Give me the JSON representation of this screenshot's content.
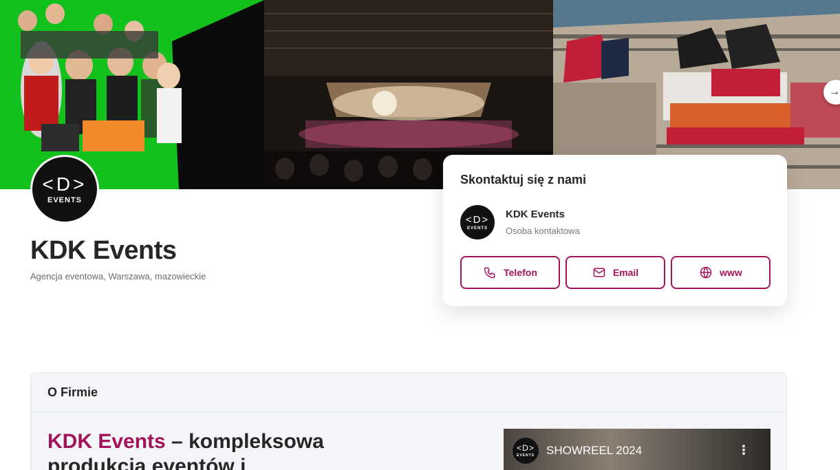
{
  "gallery": {
    "next_icon": "arrow-right-icon",
    "next_glyph": "→"
  },
  "profile": {
    "logo_mark": "‹D‹",
    "logo_sub": "EVENTS",
    "name": "KDK Events",
    "meta": "Agencja eventowa, Warszawa, mazowieckie"
  },
  "contact": {
    "title": "Skontaktuj się z nami",
    "person_name": "KDK Events",
    "person_role": "Osoba kontaktowa",
    "buttons": [
      {
        "label": "Telefon",
        "icon": "phone-icon"
      },
      {
        "label": "Email",
        "icon": "mail-icon"
      },
      {
        "label": "www",
        "icon": "globe-icon"
      }
    ]
  },
  "about": {
    "header": "O Firmie",
    "heading_brand": "KDK Events",
    "heading_rest": " – kompleksowa produkcja eventów i",
    "video_title": "SHOWREEL 2024",
    "video_menu": "⋮"
  },
  "colors": {
    "accent": "#a3135c",
    "text": "#262626",
    "muted": "#6b6b6b",
    "section_bg": "#f3f5f8"
  }
}
